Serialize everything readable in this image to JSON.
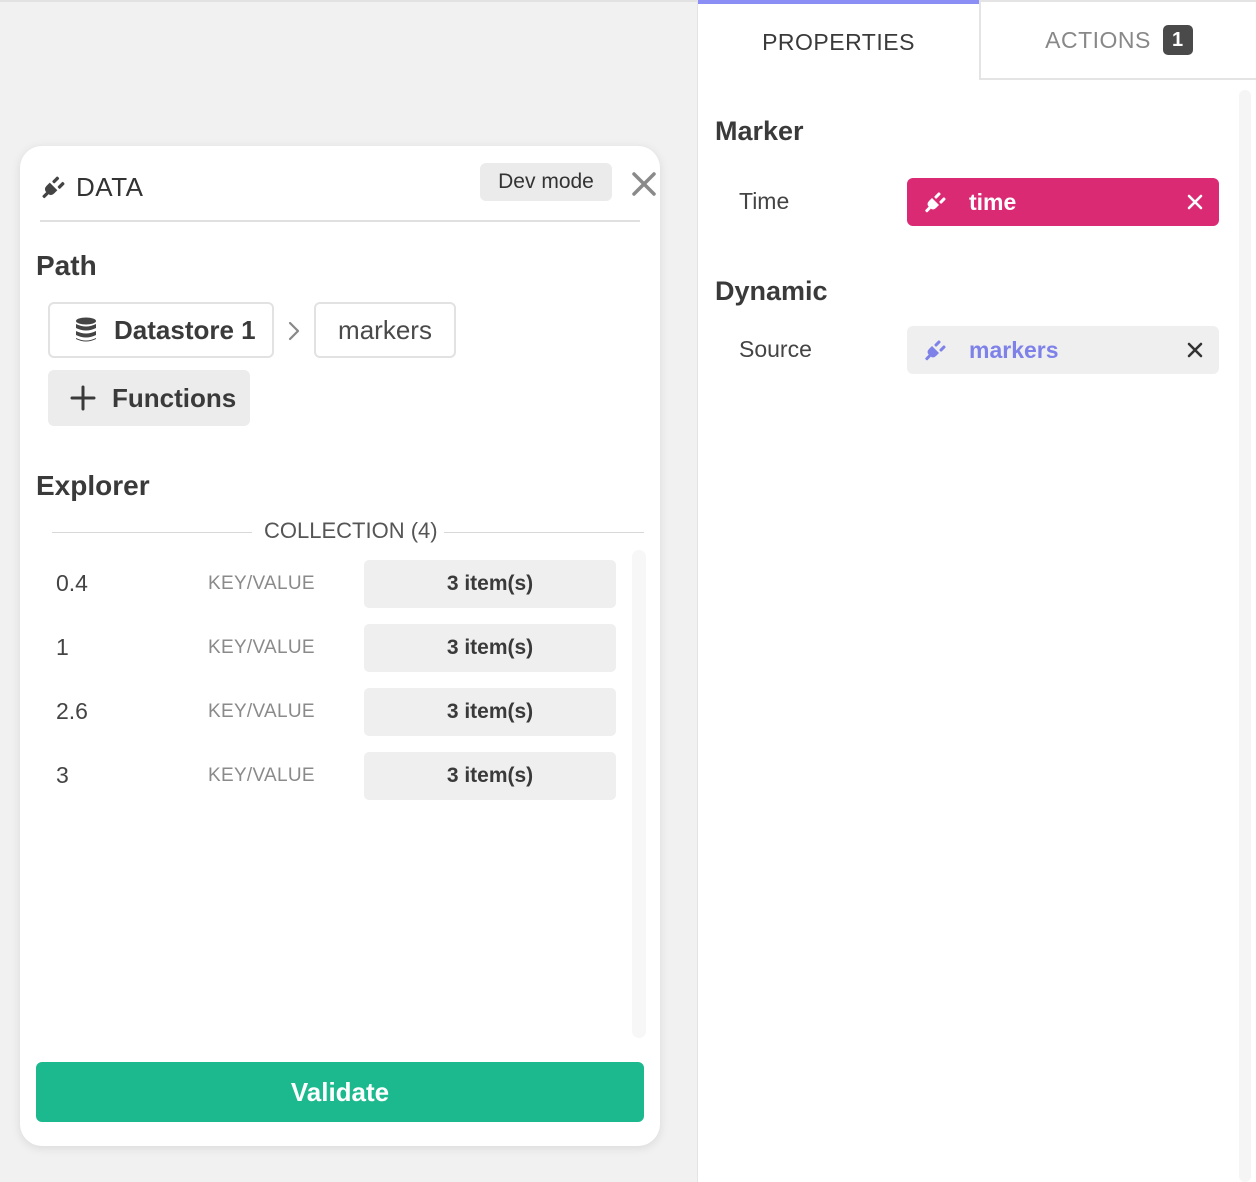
{
  "data_panel": {
    "title": "DATA",
    "dev_mode_label": "Dev mode",
    "path_heading": "Path",
    "path": {
      "datastore": "Datastore 1",
      "segment": "markers"
    },
    "functions_label": "Functions",
    "explorer_heading": "Explorer",
    "collection_label": "COLLECTION (4)",
    "rows": [
      {
        "key": "0.4",
        "type": "KEY/VALUE",
        "items": "3 item(s)"
      },
      {
        "key": "1",
        "type": "KEY/VALUE",
        "items": "3 item(s)"
      },
      {
        "key": "2.6",
        "type": "KEY/VALUE",
        "items": "3 item(s)"
      },
      {
        "key": "3",
        "type": "KEY/VALUE",
        "items": "3 item(s)"
      }
    ],
    "validate_label": "Validate"
  },
  "right_panel": {
    "tabs": {
      "properties": "PROPERTIES",
      "actions": "ACTIONS",
      "actions_badge": "1"
    },
    "marker_heading": "Marker",
    "time_label": "Time",
    "time_binding": "time",
    "dynamic_heading": "Dynamic",
    "source_label": "Source",
    "source_binding": "markers"
  },
  "colors": {
    "accent": "#8b8ef5",
    "validate": "#1cb98e",
    "time_binding": "#db2a74",
    "source_binding_text": "#7e82e8"
  },
  "icons": [
    "plug-icon",
    "close-icon",
    "database-icon",
    "chevron-right-icon",
    "plus-icon"
  ]
}
